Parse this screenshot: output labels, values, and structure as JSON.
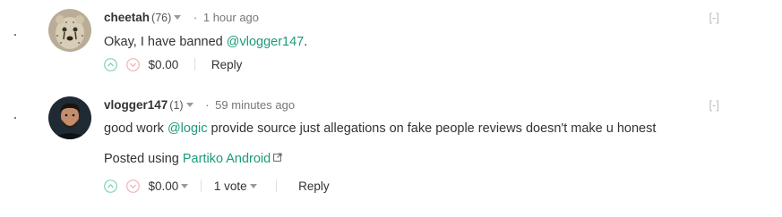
{
  "comments": [
    {
      "author": "cheetah",
      "reputation": "(76)",
      "separator": "·",
      "time": "1 hour ago",
      "collapse_label": "[-]",
      "body_prefix": "Okay, I have banned ",
      "mention": "@vlogger147",
      "body_suffix": ".",
      "payout": "$0.00",
      "reply_label": "Reply",
      "avatar_icon": "cheetah-avatar"
    },
    {
      "author": "vlogger147",
      "reputation": "(1)",
      "separator": "·",
      "time": "59 minutes ago",
      "collapse_label": "[-]",
      "body_prefix": "good work ",
      "mention": "@logic",
      "body_suffix": " provide source just allegations on fake people reviews doesn't make u honest",
      "posted_prefix": "Posted using ",
      "posted_link": "Partiko Android",
      "payout": "$0.00",
      "votes_label": "1 vote",
      "reply_label": "Reply",
      "avatar_icon": "user-avatar"
    }
  ],
  "colors": {
    "link": "#1a9b7a",
    "upvote": "#7fd3b8",
    "downvote": "#f2b3b3",
    "muted": "#777777"
  }
}
